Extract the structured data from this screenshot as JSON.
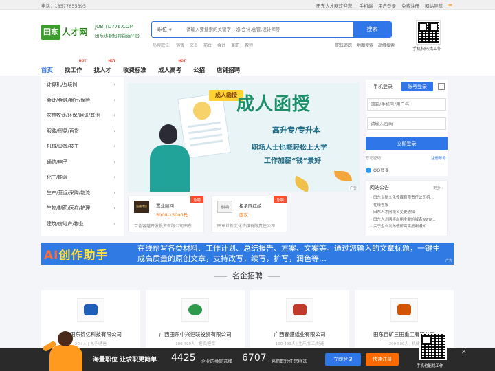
{
  "topbar": {
    "phone": "电话：18577655395",
    "links": [
      "田东人才网欢迎您!",
      "手机端",
      "用户登录",
      "免费注册",
      "网站导航"
    ]
  },
  "header": {
    "logo_badge": "田东",
    "logo_name": "人才网",
    "logo_domain": "JOB.TD776.COM",
    "logo_slogan": "田东求职招聘首选平台",
    "search_category": "职位",
    "search_placeholder": "请输入要搜索的关键字，如:会计,仓管,设计师等",
    "search_button": "搜索",
    "hot_label": "热搜职位:",
    "hot_keywords": [
      "销售",
      "文员",
      "前台",
      "会计",
      "兼职",
      "教师"
    ],
    "search_links": [
      "职位追踪",
      "地图搜索",
      "高级搜索"
    ],
    "qr_caption": "手机扫码找工作"
  },
  "nav": [
    {
      "label": "首页",
      "hot": ""
    },
    {
      "label": "找工作",
      "hot": "HOT"
    },
    {
      "label": "找人才",
      "hot": "HOT"
    },
    {
      "label": "收费标准",
      "hot": ""
    },
    {
      "label": "成人高考",
      "hot": "HOT"
    },
    {
      "label": "公招",
      "hot": ""
    },
    {
      "label": "店铺招聘",
      "hot": ""
    }
  ],
  "categories": [
    "计算机/互联网",
    "会计/金融/银行/保险",
    "农林牧渔/环保/翻译/其他",
    "服装/贸易/百货",
    "机械/设备/技工",
    "通信/电子",
    "化工/能源",
    "生产/营运/采购/物流",
    "生物/制药/医疗/护理",
    "建筑/房地产/物业"
  ],
  "banner": {
    "tag": "成人函授",
    "headline": "成人函授",
    "line1": "高升专/专升本",
    "line2": "职场人士也能轻松上大学",
    "line3": "工作加薪“钱”景好",
    "ad": "广告"
  },
  "jobs": [
    {
      "thumb": "直播传媒",
      "title": "置业顾问",
      "salary": "5000-15000元",
      "company": "百色容越开发投资有限公司田东",
      "urgent": "急聘"
    },
    {
      "thumb": "相承网",
      "title": "相承网红娘",
      "salary": "面议",
      "company": "田东世新文化传媒有限责任公司",
      "urgent": "急聘"
    }
  ],
  "login": {
    "tab_mobile": "手机登录",
    "tab_account": "账号登录",
    "user_placeholder": "邮箱/手机号/用户名",
    "pass_placeholder": "请输入密码",
    "submit": "立即登录",
    "forgot": "忘记密码",
    "register": "注册账号",
    "qq": "QQ登录"
  },
  "notice": {
    "title": "网站公告",
    "more": "更多",
    "items": [
      "田东世新文化传媒有限责任公司招…",
      "在线客服",
      "田东人才网域名变更通知",
      "田东人才网将启用全新的域名www…",
      "关于企业发布低薪高实抵制通知"
    ]
  },
  "ai_banner": {
    "brand_a": "AI",
    "brand_b": "创作助手",
    "text": "在线帮写各类材料、工作计划、总结报告、方案、文案等。通过您输入的文章标题，一键生成高质量的原创文章，支持改写，续写，扩写，润色等…",
    "ad": "广告"
  },
  "famous": {
    "title": "名企招聘",
    "companies": [
      {
        "name": "广西田东锦亿科技有限公司",
        "sub": "20+人 | 电子/通信",
        "color": "#1f5fb8"
      },
      {
        "name": "广西田东中兴恒联投资有限公司",
        "sub": "100-499人 | 投资/担保",
        "color": "#2e9a4c"
      },
      {
        "name": "广西春盛纸业有限公司",
        "sub": "100-499人 | 生产/加工/制造",
        "color": "#c0392b"
      },
      {
        "name": "田东百矿三田重工有限公司",
        "sub": "200-500人 | 机械",
        "color": "#d35400"
      }
    ]
  },
  "bottom_bar": {
    "slogan": "海量职位 让求职更简单",
    "count1": "4425",
    "count1_text": "+企业的共同选择",
    "count2": "6707",
    "count2_text": "+高薪职位任您挑选",
    "login_btn": "立即登录",
    "register_btn": "快速注册",
    "qr_caption": "手机也能找工作",
    "close": "✕"
  }
}
